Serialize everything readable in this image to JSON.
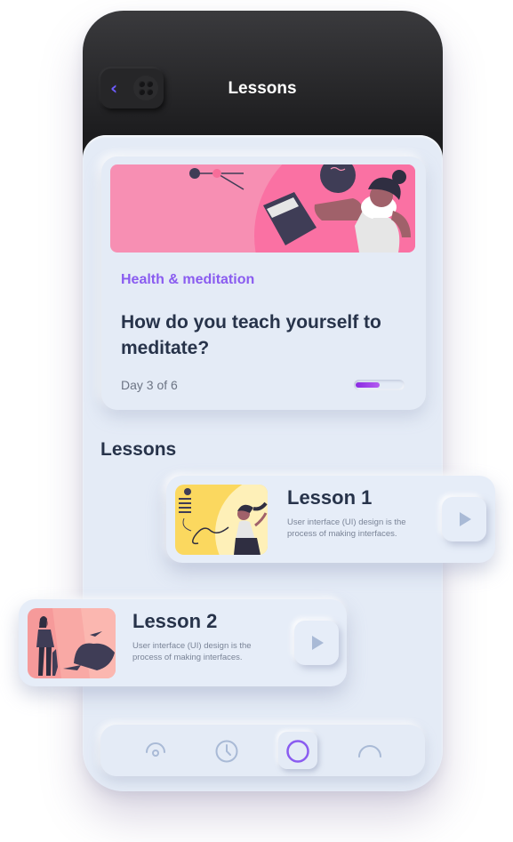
{
  "header": {
    "title": "Lessons",
    "back_icon": "chevron-left-icon",
    "menu_icon": "grid-dots-icon"
  },
  "course": {
    "category": "Health & meditation",
    "title": "How do you teach yourself to meditate?",
    "progress_text": "Day 3 of 6",
    "progress_fraction": 0.5
  },
  "lessons_section": {
    "heading": "Lessons",
    "items": [
      {
        "title": "Lesson 1",
        "description": "User interface (UI) design is the process of making interfaces.",
        "thumbnail": "woman-dancing-illustration"
      },
      {
        "title": "Lesson 2",
        "description": "User interface (UI) design is the process of making interfaces.",
        "thumbnail": "woman-walking-illustration"
      }
    ]
  },
  "bottom_nav": {
    "items": [
      {
        "icon": "gauge-icon",
        "active": false
      },
      {
        "icon": "clock-icon",
        "active": false
      },
      {
        "icon": "circle-icon",
        "active": true
      },
      {
        "icon": "arc-icon",
        "active": false
      }
    ]
  },
  "colors": {
    "accent": "#8a5cf0",
    "text_dark": "#27334a",
    "background": "#e4ebf6",
    "header_dark": "#1c1c1e"
  }
}
